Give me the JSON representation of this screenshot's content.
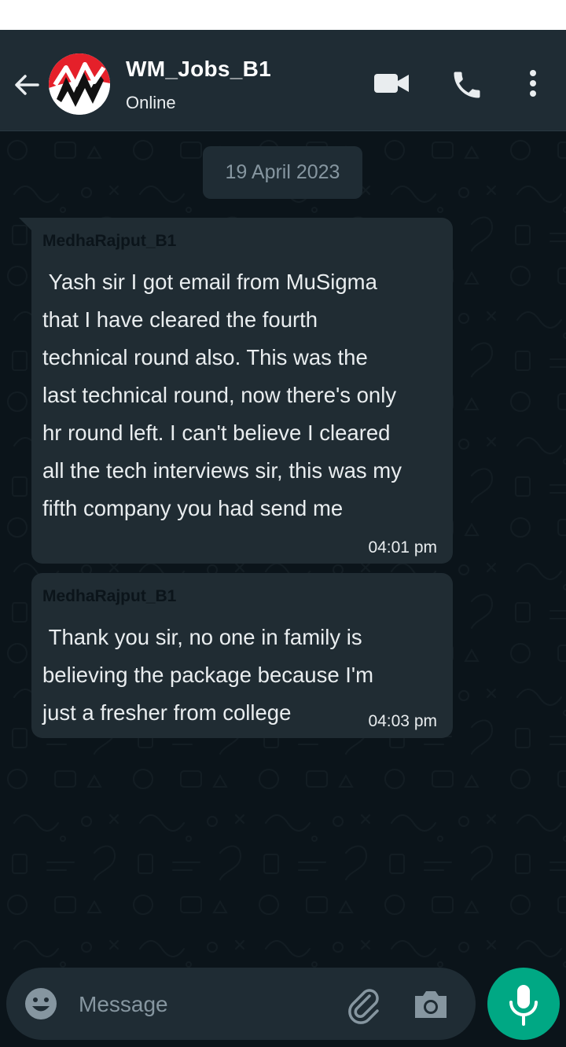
{
  "header": {
    "title": "WM_Jobs_B1",
    "status": "Online",
    "icons": [
      "back-arrow-icon",
      "group-avatar",
      "video-call-icon",
      "voice-call-icon",
      "more-vert-icon"
    ]
  },
  "chat": {
    "date_chip": "19 April 2023",
    "messages": [
      {
        "sender": "MedhaRajput_B1",
        "text": " Yash sir I got email from MuSigma\nthat I have cleared the fourth\ntechnical round also. This was the\nlast technical round, now there's only\nhr round left. I can't believe I cleared\nall the tech interviews sir, this was my\nfifth company you had send me",
        "time": "04:01 pm"
      },
      {
        "sender": "MedhaRajput_B1",
        "text": " Thank you sir, no one in family is\nbelieving the package because I'm\njust a fresher from college",
        "time": "04:03 pm"
      }
    ]
  },
  "composer": {
    "placeholder": "Message",
    "icons": [
      "emoji-icon",
      "attach-icon",
      "camera-icon",
      "mic-icon"
    ]
  },
  "colors": {
    "header_bg": "#1f2c34",
    "chat_bg": "#0b141a",
    "bubble_bg": "#202c33",
    "accent": "#00a884"
  }
}
